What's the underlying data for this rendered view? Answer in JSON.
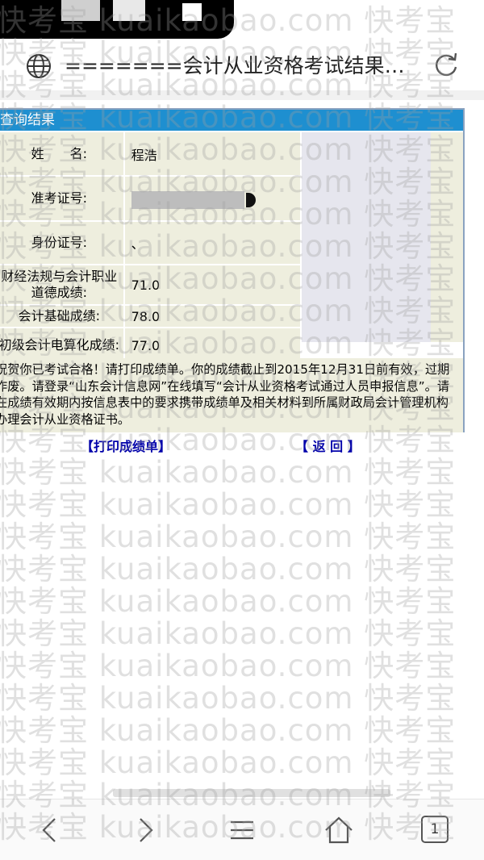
{
  "browser": {
    "title": "=======会计从业资格考试结果…",
    "icons": {
      "globe": "globe-icon",
      "reload": "reload-icon"
    }
  },
  "result": {
    "header": "查询结果",
    "rows": [
      {
        "label": "姓　　名:",
        "value": "程浩"
      },
      {
        "label": "准考证号:",
        "value": ""
      },
      {
        "label": "身份证号:",
        "value": "、"
      },
      {
        "label": "财经法规与会计职业道德成绩:",
        "value": "71.0"
      },
      {
        "label": "会计基础成绩:",
        "value": "78.0"
      },
      {
        "label": "初级会计电算化成绩:",
        "value": "77.0"
      }
    ],
    "notice": "祝贺你已考试合格！请打印成绩单。你的成绩截止到2015年12月31日前有效，过期作废。请登录“山东会计信息网”在线填写“会计从业资格考试通过人员申报信息”。请在成绩有效期内按信息表中的要求携带成绩单及相关材料到所属财政局会计管理机构办理会计从业资格证书。"
  },
  "links": {
    "print": "【打印成绩单】",
    "back": "【 返 回 】"
  },
  "nav": {
    "tab_count": "1",
    "icons": [
      "back-icon",
      "forward-icon",
      "menu-icon",
      "home-icon",
      "tabs-icon"
    ]
  },
  "watermark": {
    "text": "快考宝 kuaikaobao.com 快考宝"
  },
  "colors": {
    "header_bg": "#1e8fd0",
    "cell_bg": "#eeeede",
    "link": "#0000aa"
  }
}
